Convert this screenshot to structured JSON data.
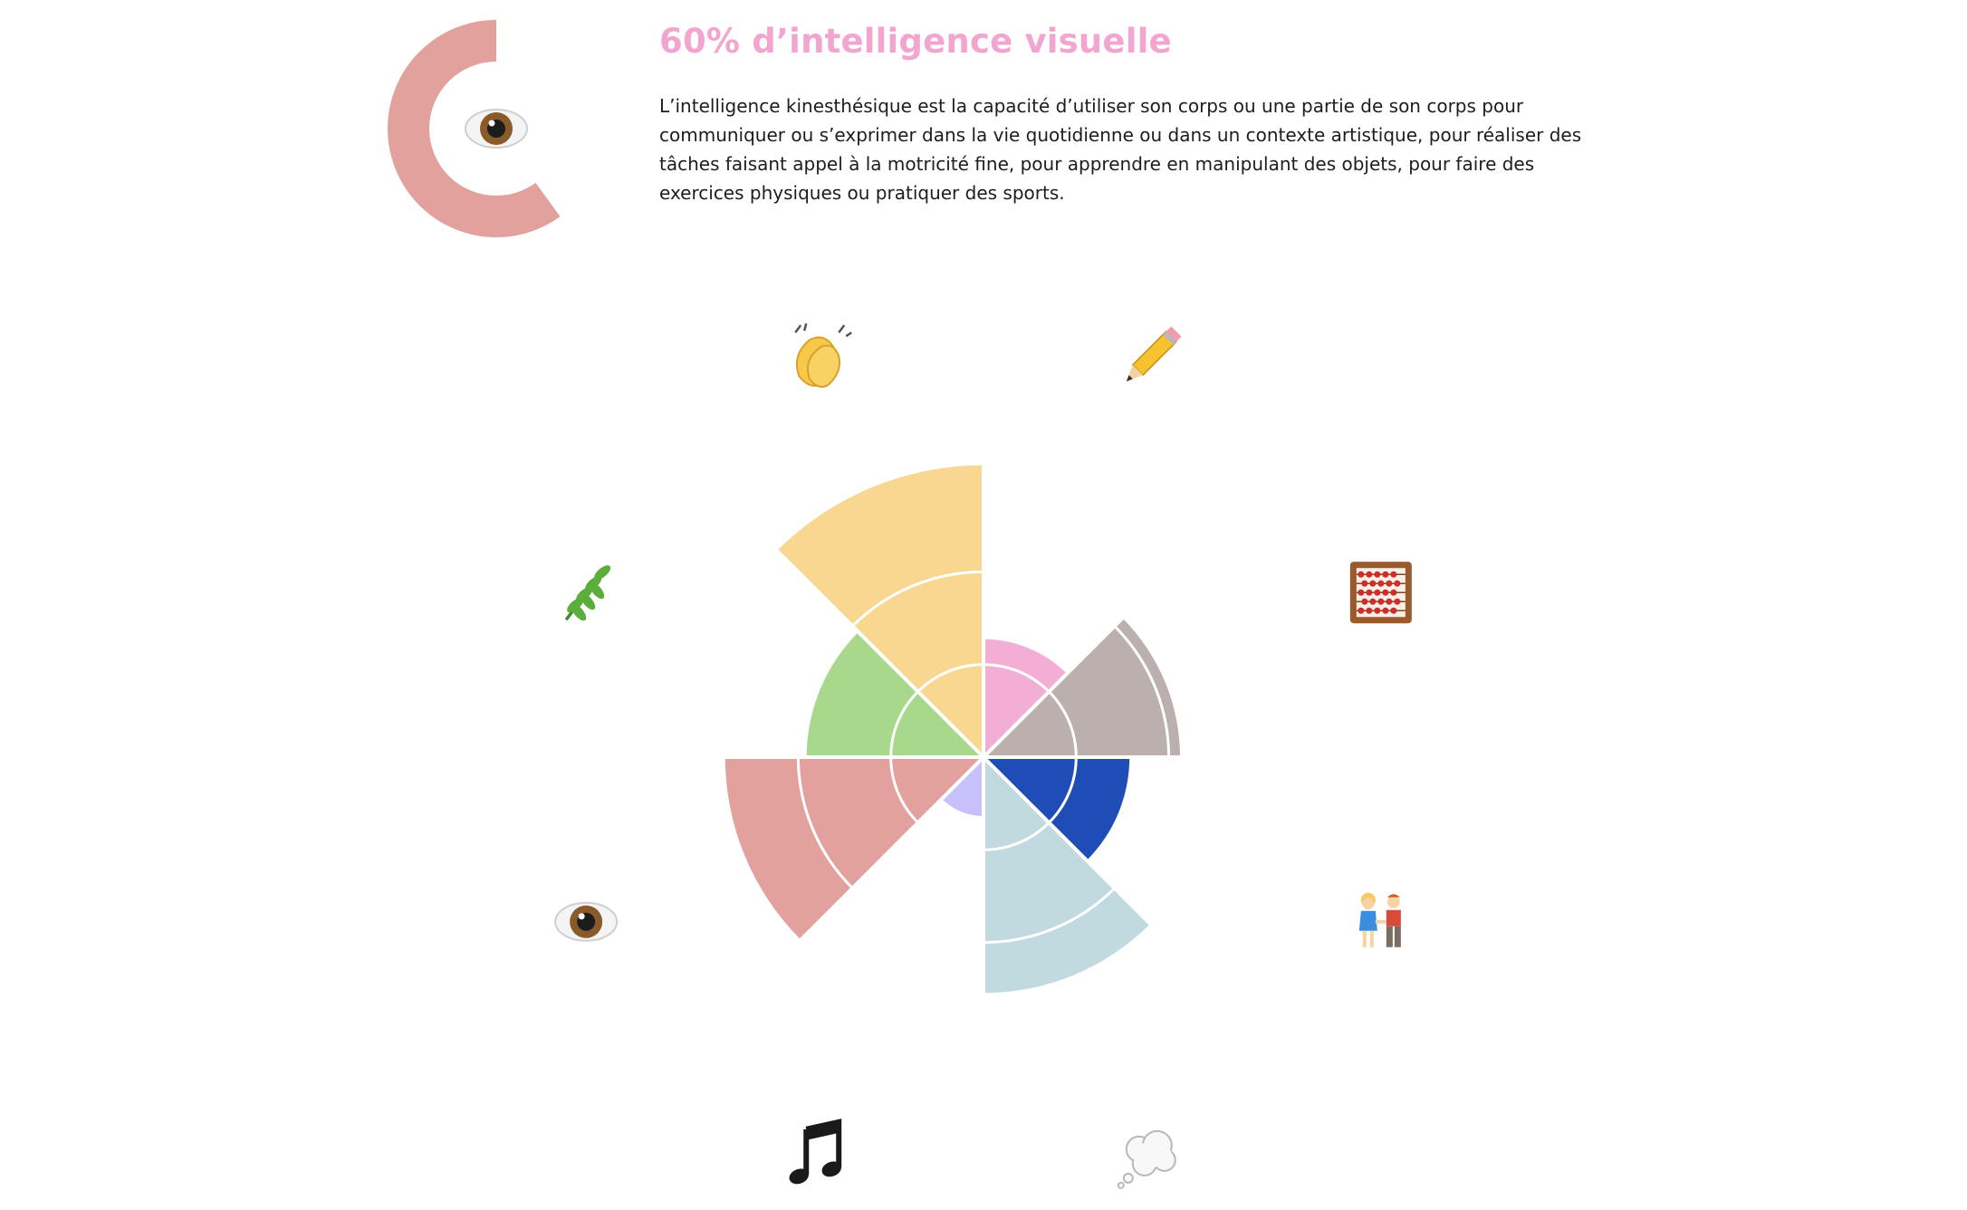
{
  "header": {
    "title": "60% d’intelligence visuelle",
    "title_color": "#f2a6cf",
    "ring_color": "#e2a19d",
    "ring_track_color": "#e2a19d",
    "ring_percent": 0.6,
    "center_icon": "eye-icon",
    "description": "L’intelligence kinesthésique est la capacité d’utiliser son corps ou une partie de son corps pour communiquer ou s’exprimer dans la vie quotidienne ou dans un contexte artistique, pour réaliser des tâches faisant appel à la motricité fine, pour apprendre en manipulant des objets, pour faire des exercices physiques ou pratiquer des sports."
  },
  "chart_data": {
    "type": "polar-area",
    "max": 100,
    "rings": [
      33,
      66
    ],
    "segments": [
      {
        "key": "interpersonnelle",
        "icon": "people-holding-hands-icon",
        "value": 52,
        "color": "#1f4db8"
      },
      {
        "key": "intrapersonnelle",
        "icon": "thought-balloon-icon",
        "value": 84,
        "color": "#c1dae0"
      },
      {
        "key": "musicale",
        "icon": "musical-notes-icon",
        "value": 21,
        "color": "#c8c0fa"
      },
      {
        "key": "visuelle",
        "icon": "eye-icon",
        "value": 92,
        "color": "#e2a19d"
      },
      {
        "key": "naturaliste",
        "icon": "herb-icon",
        "value": 63,
        "color": "#a8d88c"
      },
      {
        "key": "kinesthesique",
        "icon": "clapping-hands-icon",
        "value": 104,
        "color": "#f8d890"
      },
      {
        "key": "linguistique",
        "icon": "pencil-icon",
        "value": 42,
        "color": "#f2aed4"
      },
      {
        "key": "logico-mathematique",
        "icon": "abacus-icon",
        "value": 70,
        "color": "#bcb0ae"
      }
    ]
  }
}
